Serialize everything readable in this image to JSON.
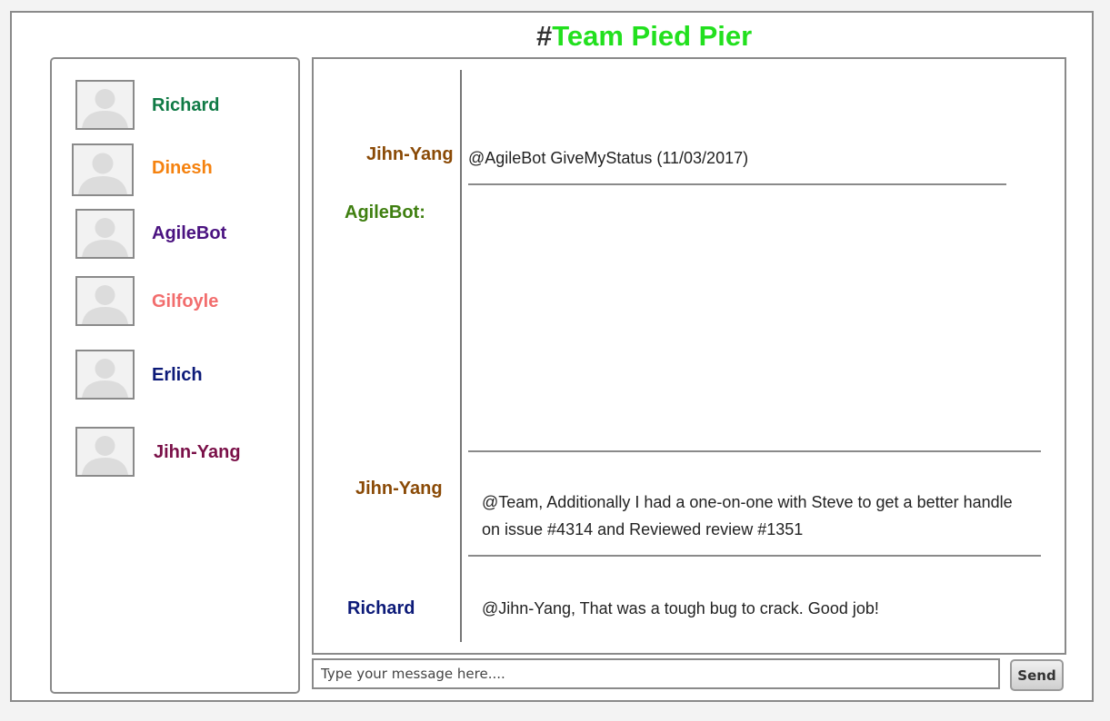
{
  "channel": {
    "hash": "#",
    "name": "Team Pied Pier",
    "name_color": "#22e01e"
  },
  "members": [
    {
      "name": "Richard",
      "color": "#0f7a45",
      "avatar_icon": "user-placeholder-icon"
    },
    {
      "name": "Dinesh",
      "color": "#f5820f",
      "avatar_icon": "user-placeholder-icon"
    },
    {
      "name": "AgileBot",
      "color": "#4a1280",
      "avatar_icon": "user-placeholder-icon"
    },
    {
      "name": "Gilfoyle",
      "color": "#f26d6d",
      "avatar_icon": "user-placeholder-icon"
    },
    {
      "name": "Erlich",
      "color": "#0c1a78",
      "avatar_icon": "user-placeholder-icon"
    },
    {
      "name": "Jihn-Yang",
      "color": "#7a1048",
      "avatar_icon": "user-placeholder-icon"
    }
  ],
  "messages": [
    {
      "sender": "Jihn-Yang",
      "sender_color": "#8a4a06",
      "text": "@AgileBot GiveMyStatus (11/03/2017)"
    },
    {
      "sender": "AgileBot:",
      "sender_color": "#3f7f10",
      "text": ""
    },
    {
      "sender": "Jihn-Yang",
      "sender_color": "#8a4a06",
      "text": "@Team,  Additionally I had a one-on-one with Steve to get a better handle on issue #4314 and Reviewed review #1351"
    },
    {
      "sender": "Richard",
      "sender_color": "#0c1a78",
      "text": "@Jihn-Yang, That was a tough bug to crack. Good job!"
    }
  ],
  "composer": {
    "placeholder": "Type your message here....",
    "send_label": "Send"
  }
}
